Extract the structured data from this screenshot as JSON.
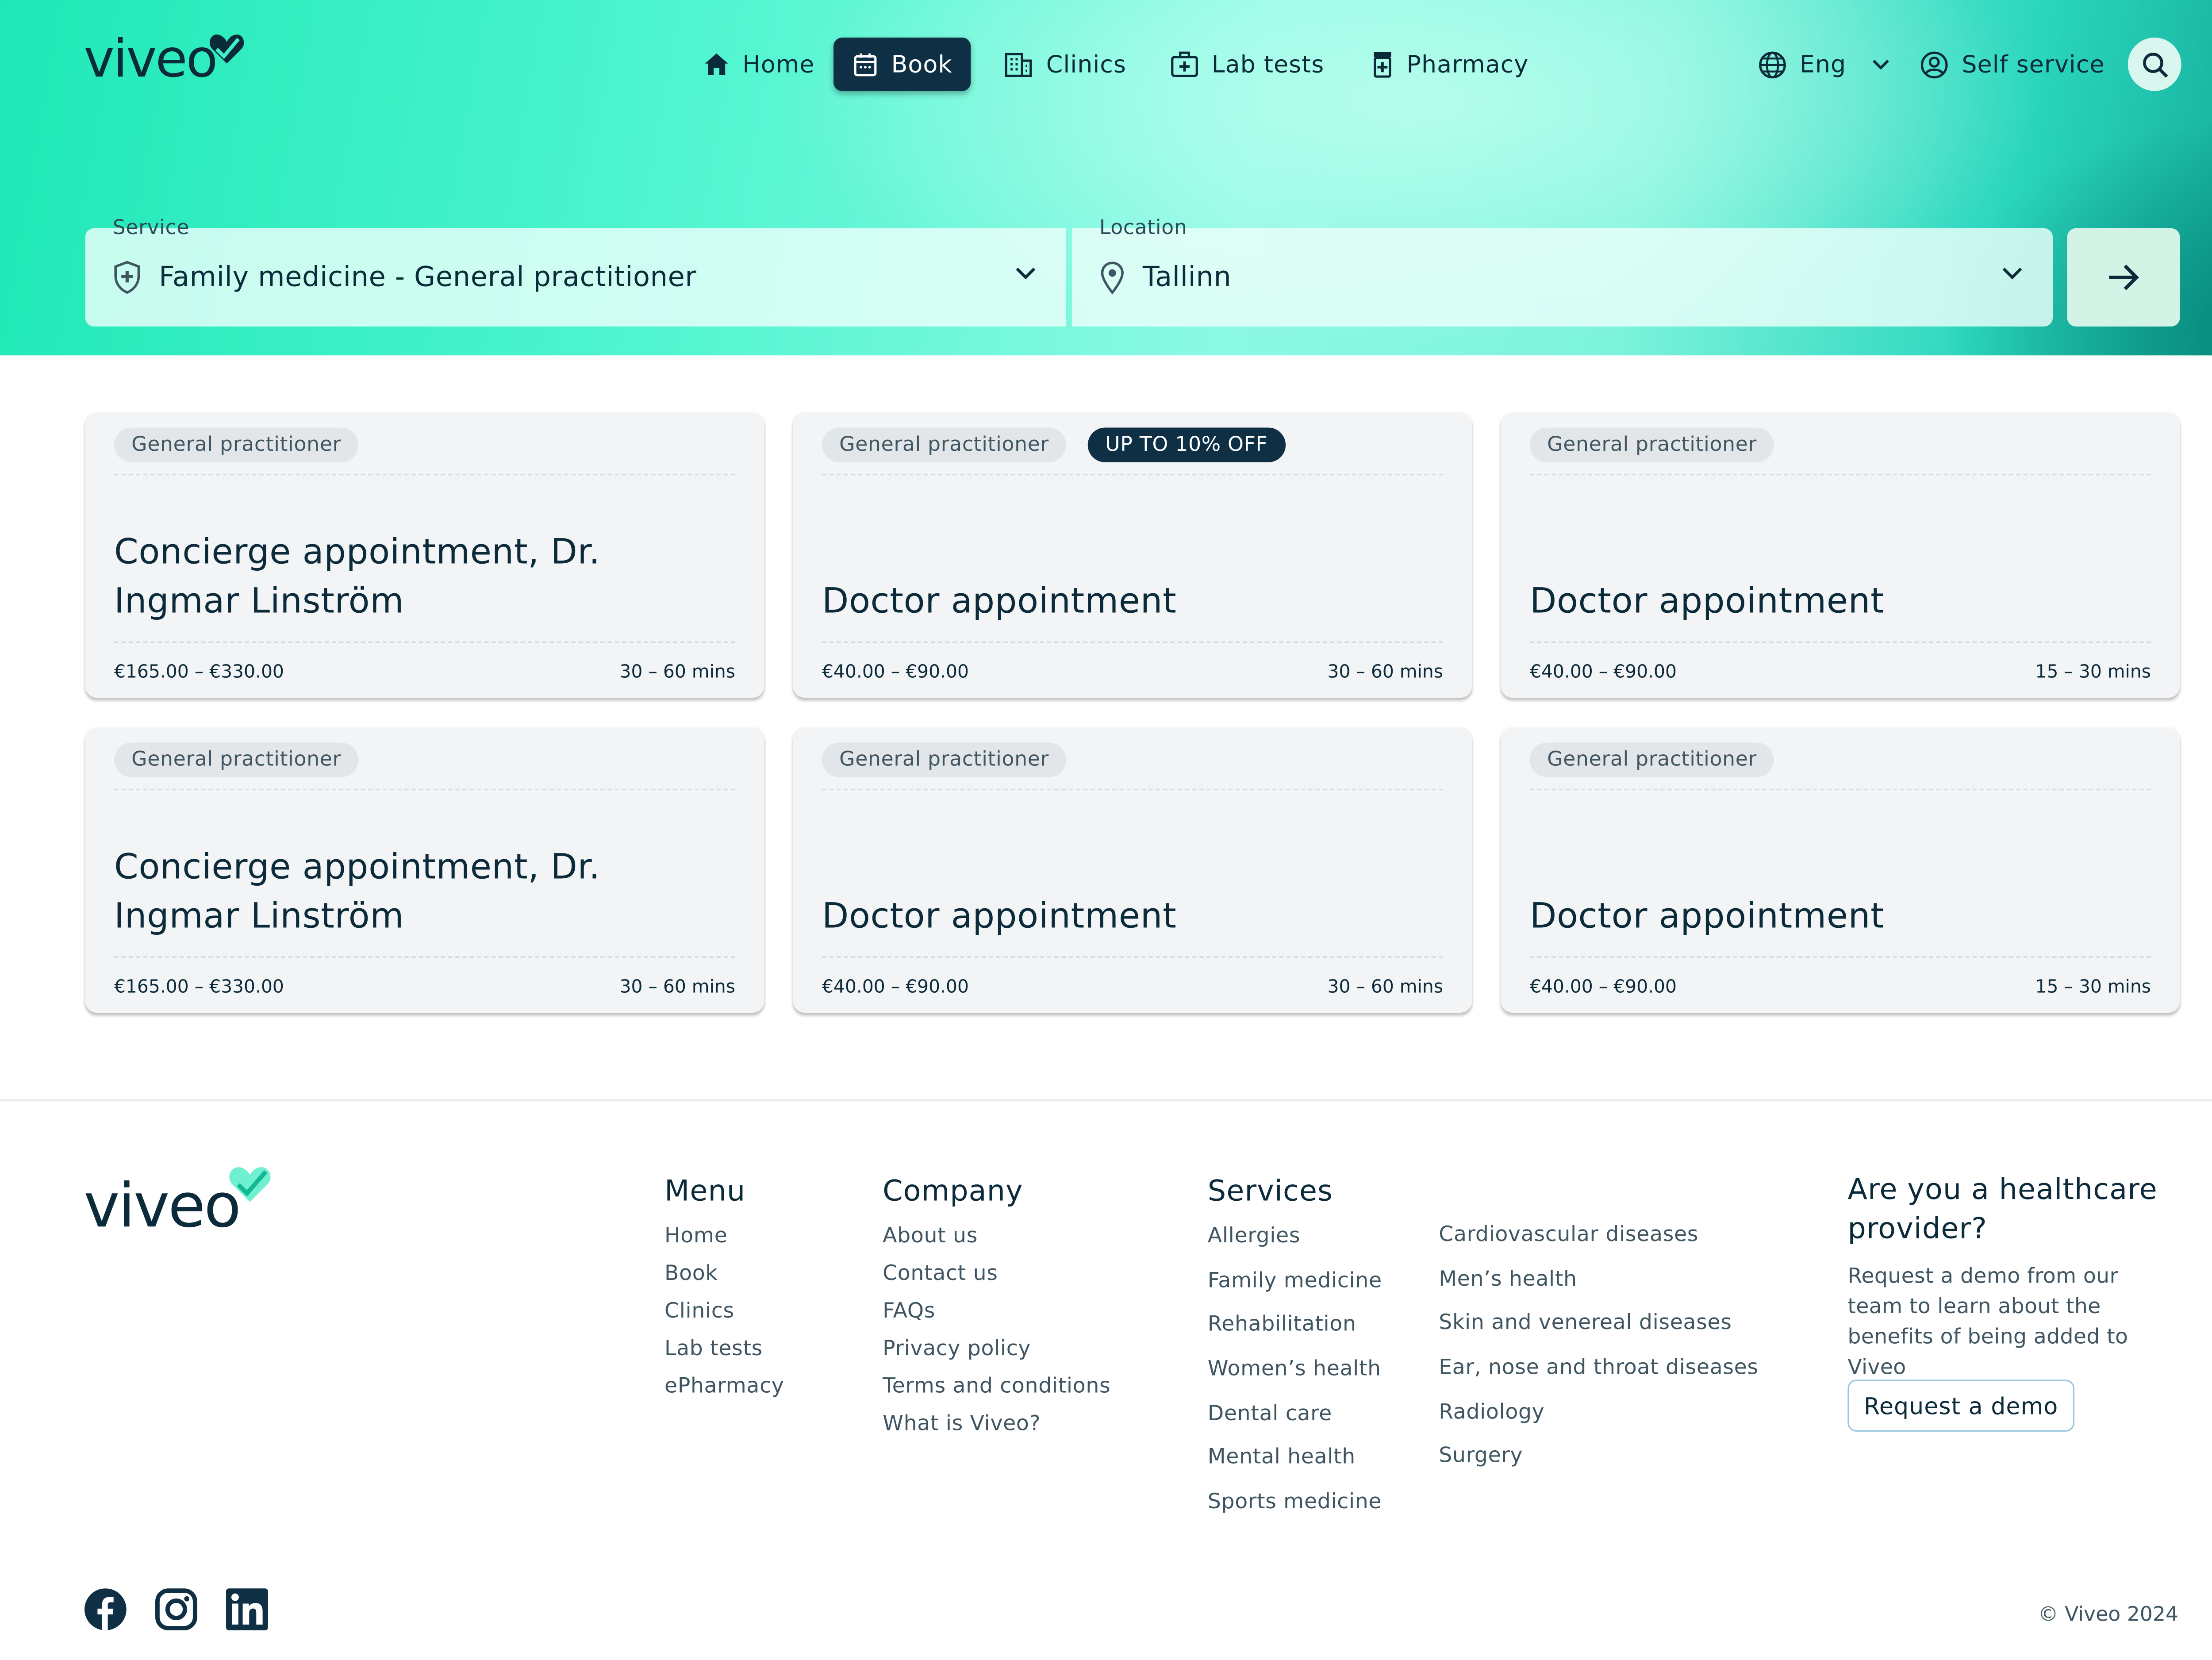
{
  "brand": {
    "name": "viveo"
  },
  "nav": {
    "items": [
      {
        "label": "Home",
        "icon": "home-icon"
      },
      {
        "label": "Book",
        "icon": "calendar-icon",
        "active": true
      },
      {
        "label": "Clinics",
        "icon": "building-icon"
      },
      {
        "label": "Lab tests",
        "icon": "medical-kit-icon"
      },
      {
        "label": "Pharmacy",
        "icon": "pill-bottle-icon"
      }
    ],
    "language": "Eng",
    "self_service": "Self service"
  },
  "search": {
    "service_label": "Service",
    "service_value": "Family medicine - General practitioner",
    "location_label": "Location",
    "location_value": "Tallinn"
  },
  "cards": [
    {
      "tag": "General practitioner",
      "title": "Concierge appointment, Dr. Ingmar Linström",
      "price": "€165.00 – €330.00",
      "duration": "30 – 60 mins"
    },
    {
      "tag": "General practitioner",
      "promo": "UP TO 10% OFF",
      "title": "Doctor appointment",
      "price": "€40.00 – €90.00",
      "duration": "30 – 60 mins"
    },
    {
      "tag": "General practitioner",
      "title": "Doctor appointment",
      "price": "€40.00 – €90.00",
      "duration": "15 – 30 mins"
    },
    {
      "tag": "General practitioner",
      "title": "Concierge appointment, Dr. Ingmar Linström",
      "price": "€165.00 – €330.00",
      "duration": "30 – 60 mins"
    },
    {
      "tag": "General practitioner",
      "title": "Doctor appointment",
      "price": "€40.00 – €90.00",
      "duration": "30 – 60 mins"
    },
    {
      "tag": "General practitioner",
      "title": "Doctor appointment",
      "price": "€40.00 – €90.00",
      "duration": "15 – 30 mins"
    }
  ],
  "footer": {
    "menu": {
      "title": "Menu",
      "items": [
        "Home",
        "Book",
        "Clinics",
        "Lab tests",
        "ePharmacy"
      ]
    },
    "company": {
      "title": "Company",
      "items": [
        "About us",
        "Contact us",
        "FAQs",
        "Privacy policy",
        "Terms and conditions",
        "What is Viveo?"
      ]
    },
    "services": {
      "title": "Services",
      "col1": [
        "Allergies",
        "Family medicine",
        "Rehabilitation",
        "Women’s health",
        "Dental care",
        "Mental health",
        "Sports medicine"
      ],
      "col2": [
        "Cardiovascular diseases",
        "Men’s health",
        "Skin and venereal diseases",
        "Ear, nose and throat diseases",
        "Radiology",
        "Surgery"
      ]
    },
    "provider": {
      "title": "Are you a healthcare provider?",
      "text": "Request a demo from our team to learn about the benefits of being added to Viveo",
      "button": "Request a demo"
    },
    "socials": [
      "facebook-icon",
      "instagram-icon",
      "linkedin-icon"
    ],
    "copyright": "© Viveo 2024"
  },
  "colors": {
    "navy": "#0f2f45",
    "mint": "#1fe8b6",
    "card_bg": "#f3f4f6"
  }
}
